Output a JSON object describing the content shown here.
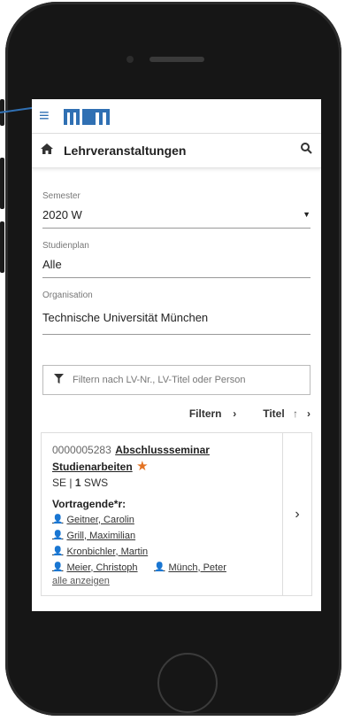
{
  "header": {
    "brand_logo": "TUM",
    "menu_icon": "hamburger-icon"
  },
  "titlebar": {
    "title": "Lehrveranstaltungen",
    "home_icon": "home-icon",
    "search_icon": "search-icon"
  },
  "filters": {
    "semester": {
      "label": "Semester",
      "value": "2020 W"
    },
    "studienplan": {
      "label": "Studienplan",
      "value": "Alle"
    },
    "organisation": {
      "label": "Organisation",
      "value": "Technische Universität München"
    }
  },
  "search": {
    "placeholder": "Filtern nach LV-Nr., LV-Titel oder Person"
  },
  "actions": {
    "filter_label": "Filtern",
    "sort_label": "Titel"
  },
  "course": {
    "number": "0000005283",
    "title_line1": "Abschlussseminar",
    "title_line2": "Studienarbeiten",
    "type": "SE",
    "sws_value": "1",
    "sws_unit": "SWS",
    "lecturers_label": "Vortragende*r:",
    "lecturers": [
      "Geitner, Carolin",
      "Grill, Maximilian",
      "Kronbichler, Martin",
      "Meier, Christoph",
      "Münch, Peter"
    ],
    "show_all": "alle anzeigen"
  },
  "colors": {
    "accent": "#3070b3",
    "favorite": "#e37222"
  }
}
